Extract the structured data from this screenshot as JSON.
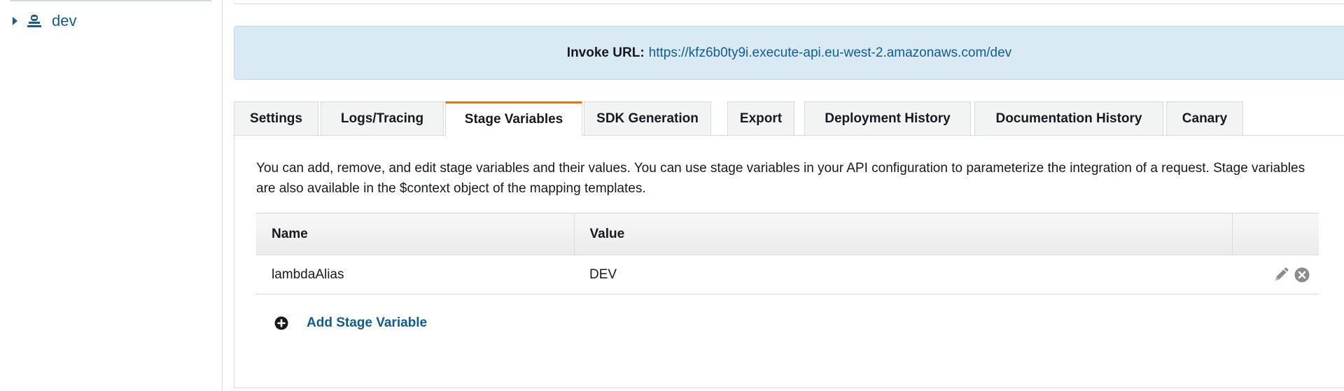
{
  "stage_tree": {
    "items": [
      {
        "label": "dev",
        "icon": "stage-icon",
        "expanded": false
      }
    ]
  },
  "invoke": {
    "label": "Invoke URL:",
    "url": "https://kfz6b0ty9i.execute-api.eu-west-2.amazonaws.com/dev"
  },
  "tabs": [
    {
      "label": "Settings",
      "active": false
    },
    {
      "label": "Logs/Tracing",
      "active": false
    },
    {
      "label": "Stage Variables",
      "active": true
    },
    {
      "label": "SDK Generation",
      "active": false
    },
    {
      "label": "Export",
      "active": false
    },
    {
      "label": "Deployment History",
      "active": false
    },
    {
      "label": "Documentation History",
      "active": false
    },
    {
      "label": "Canary",
      "active": false
    }
  ],
  "stage_variables": {
    "description": "You can add, remove, and edit stage variables and their values. You can use stage variables in your API configuration to parameterize the integration of a request. Stage variables are also available in the $context object of the mapping templates.",
    "columns": [
      "Name",
      "Value",
      ""
    ],
    "rows": [
      {
        "name": "lambdaAlias",
        "value": "DEV"
      }
    ],
    "add_label": "Add Stage Variable"
  },
  "colors": {
    "accent": "#ec7211",
    "link": "#0e5c95",
    "info_bg": "#d9eaf5",
    "icon_gray": "#8c8c8c"
  }
}
